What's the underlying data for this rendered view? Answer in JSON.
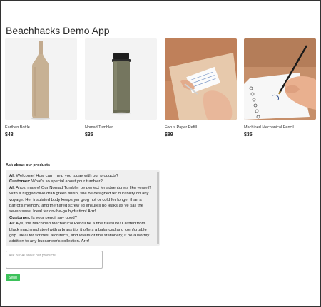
{
  "app": {
    "title": "Beachhacks Demo App"
  },
  "products": [
    {
      "name": "Earthen Bottle",
      "price": "$48",
      "image_icon": "bottle-image"
    },
    {
      "name": "Nomad Tumbler",
      "price": "$35",
      "image_icon": "tumbler-image"
    },
    {
      "name": "Focus Paper Refill",
      "price": "$89",
      "image_icon": "paper-refill-image"
    },
    {
      "name": "Machined Mechanical Pencil",
      "price": "$35",
      "image_icon": "pencil-image"
    }
  ],
  "chat": {
    "heading": "Ask about our products",
    "messages": [
      {
        "speaker": "AI:",
        "text": "Welcome! How can I help you today with our products?"
      },
      {
        "speaker": "Customer:",
        "text": "What's so special about your tumbler?"
      },
      {
        "speaker": "AI:",
        "text": "Ahoy, matey! Our Nomad Tumbler be perfect fer adventurers like yerself! With a rugged olive drab green finish, she be designed fer durability on any voyage. Her insulated body keeps yer grog hot or cold fer longer than a parrot's memory, and the flared screw lid ensures no leaks as ye sail the seven seas. Ideal fer on-the-go hydration! Arrr!"
      },
      {
        "speaker": "Customer:",
        "text": "Is your pencil any good?"
      },
      {
        "speaker": "AI:",
        "text": "Aye, the Machined Mechanical Pencil be a fine treasure! Crafted from black machined steel with a brass tip, it offers a balanced and comfortable grip. Ideal for scribes, architects, and lovers of fine stationery, it be a worthy addition to any buccaneer's collection. Arrr!"
      }
    ],
    "input_placeholder": "Ask our AI about our products",
    "input_value": "",
    "send_label": "Send"
  },
  "colors": {
    "send_button": "#3cc15a",
    "chat_bg": "#efefef",
    "card_bg": "#f4f4f4"
  }
}
